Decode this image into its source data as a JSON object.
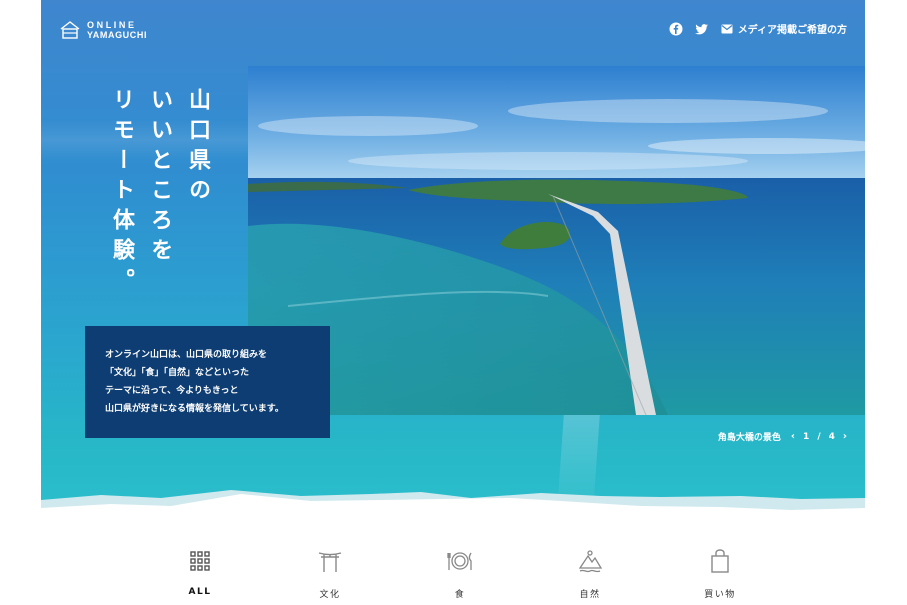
{
  "brand": {
    "line1": "ONLINE",
    "line2": "YAMAGUCHI"
  },
  "header": {
    "media_link": "メディア掲載ご希望の方",
    "icons": [
      "facebook-icon",
      "twitter-icon",
      "mail-icon"
    ]
  },
  "hero": {
    "title_lines": [
      "山口県の",
      "いいところを",
      "リモート体験。"
    ],
    "intro_lines": [
      "オンライン山口は、山口県の取り組みを",
      "「文化」「食」「自然」などといった",
      "テーマに沿って、今よりもきっと",
      "山口県が好きになる情報を発信しています。"
    ],
    "caption": "角島大橋の景色",
    "pager": {
      "current": "1",
      "separator": "/",
      "total": "4",
      "prev": "‹",
      "next": "›"
    }
  },
  "categories": [
    {
      "label": "ALL",
      "icon": "grid-icon",
      "active": true
    },
    {
      "label": "文化",
      "icon": "torii-icon",
      "active": false
    },
    {
      "label": "食",
      "icon": "dish-icon",
      "active": false
    },
    {
      "label": "自然",
      "icon": "nature-icon",
      "active": false
    },
    {
      "label": "買い物",
      "icon": "shopping-bag-icon",
      "active": false
    }
  ],
  "colors": {
    "hero_top": "#3f86cf",
    "hero_bottom": "#2bbfcb",
    "intro_box": "#0d3d72"
  }
}
